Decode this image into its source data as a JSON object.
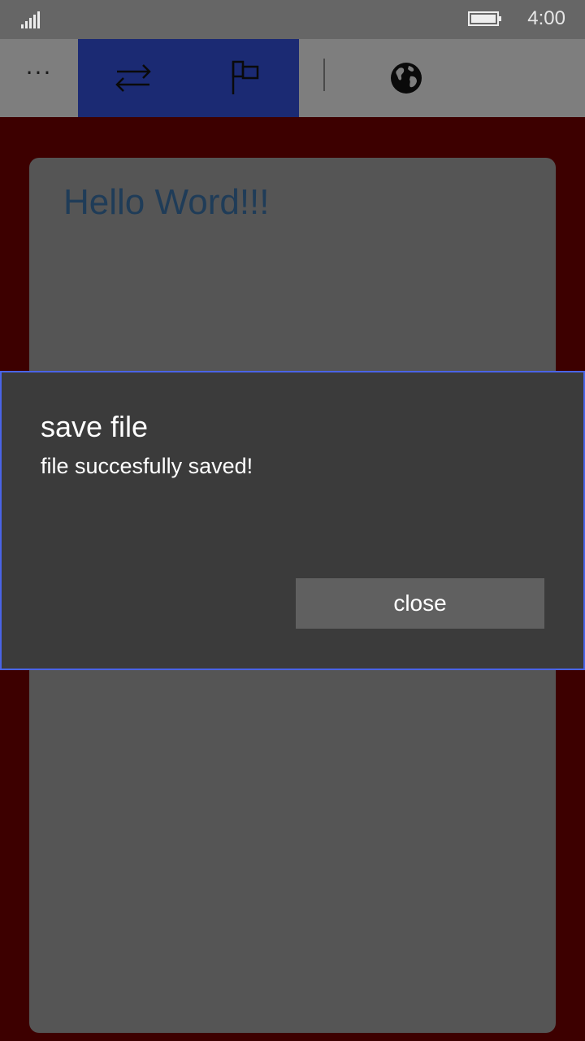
{
  "status_bar": {
    "time": "4:00",
    "signal_icon": "signal-strength-icon",
    "battery_icon": "battery-icon"
  },
  "app_bar": {
    "more_label": "···",
    "buttons": [
      {
        "icon": "swap-arrows-icon"
      },
      {
        "icon": "flag-icon"
      },
      {
        "icon": "globe-icon"
      }
    ],
    "selected_color": "#1b2a73"
  },
  "document": {
    "text": "Hello Word!!!"
  },
  "dialog": {
    "title": "save file",
    "message": "file succesfully saved!",
    "close_label": "close",
    "border_color": "#4a64e6"
  },
  "colors": {
    "page_background": "#3d0000",
    "card_background": "#555555",
    "dialog_background": "#3b3b3b"
  }
}
